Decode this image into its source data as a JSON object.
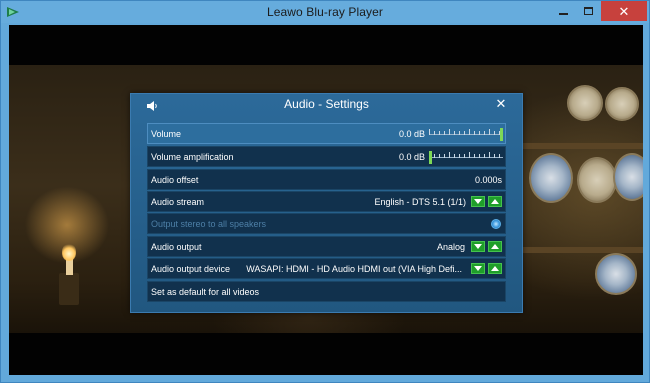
{
  "window": {
    "title": "Leawo Blu-ray Player",
    "icons": {
      "app": "leawo-app-icon",
      "minimize": "minimize-icon",
      "maximize": "maximize-icon",
      "close": "close-icon"
    }
  },
  "dialog": {
    "title": "Audio - Settings",
    "icons": {
      "speaker": "speaker-icon",
      "close": "close-icon"
    },
    "rows": {
      "volume": {
        "label": "Volume",
        "value": "0.0 dB",
        "level": 1.0
      },
      "volume_amplification": {
        "label": "Volume amplification",
        "value": "0.0 dB",
        "level": 0.0
      },
      "audio_offset": {
        "label": "Audio offset",
        "value": "0.000s"
      },
      "audio_stream": {
        "label": "Audio stream",
        "value": "English - DTS 5.1 (1/1)"
      },
      "output_stereo": {
        "label": "Output stereo to all speakers",
        "enabled": false
      },
      "audio_output": {
        "label": "Audio output",
        "value": "Analog"
      },
      "audio_output_device": {
        "label": "Audio output device",
        "value": "WASAPI: HDMI - HD Audio HDMI out (VIA High Defi..."
      },
      "set_default": {
        "label": "Set as default for all videos"
      }
    }
  },
  "colors": {
    "window_border": "#62a9db",
    "dialog_bg": "#215780",
    "row_bg": "#11314d",
    "row_highlight": "#2d6e9e",
    "accent_green": "#1f9e2a",
    "close_red": "#c7413d"
  }
}
